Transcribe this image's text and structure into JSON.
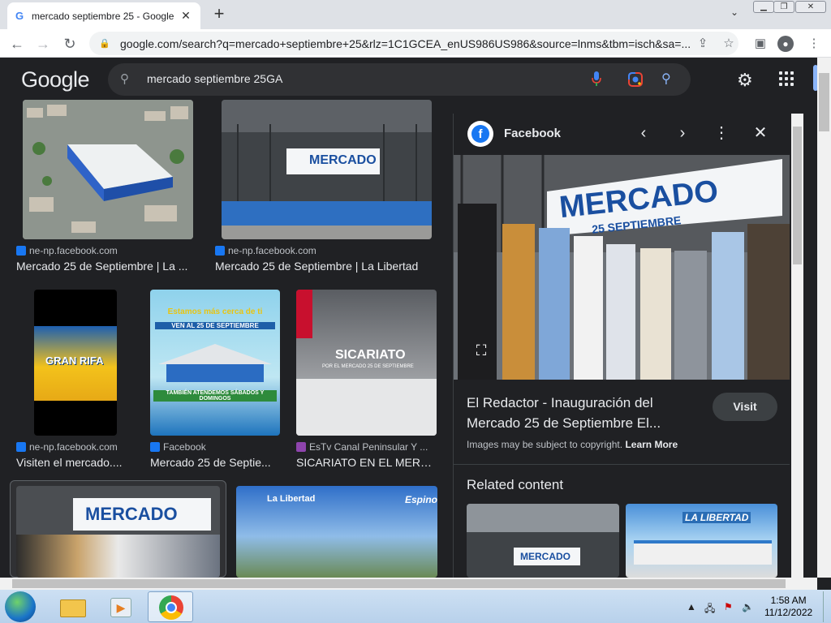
{
  "browser": {
    "tab_title": "mercado septiembre 25 - Google",
    "tab_close": "✕",
    "new_tab": "+",
    "url": "google.com/search?q=mercado+septiembre+25&rlz=1C1GCEA_enUS986US986&source=lnms&tbm=isch&sa=..."
  },
  "google": {
    "logo": "Google",
    "query": "mercado septiembre 25GA",
    "icons": {
      "search": "search-icon",
      "mic": "microphone-icon",
      "lens": "google-lens-icon",
      "settings": "gear-icon",
      "apps": "apps-grid-icon"
    }
  },
  "results": [
    {
      "source": "ne-np.facebook.com",
      "title": "Mercado 25 de Septiembre | La ..."
    },
    {
      "source": "ne-np.facebook.com",
      "title": "Mercado 25 de Septiembre | La Libertad"
    },
    {
      "source": "ne-np.facebook.com",
      "title": "Visiten el mercado...."
    },
    {
      "source": "Facebook",
      "title": "Mercado 25 de Septie..."
    },
    {
      "source": "EsTv Canal Peninsular Y ...",
      "title": "SICARIATO EN EL MERC..."
    }
  ],
  "thumb_text": {
    "mercado": "MERCADO",
    "septiembre": "25 SEPTIEMBRE",
    "gran_rifa": "GRAN RIFA",
    "estamos": "Estamos más cerca de ti",
    "ven": "VEN AL 25 DE SEPTIEMBRE",
    "tambien": "TAMBIÉN ATENDEMOS SÁBADOS Y DOMINGOS",
    "sicariato": "SICARIATO",
    "sicariato_sub": "POR EL MERCADO 25 DE SEPTIEMBRE",
    "la_libertad": "La Libertad",
    "espino": "Espino"
  },
  "panel": {
    "source": "Facebook",
    "title": "El Redactor - Inauguración del Mercado 25 de Septiembre El...",
    "visit": "Visit",
    "copyright": "Images may be subject to copyright.",
    "learn_more": "Learn More",
    "related": "Related content",
    "banner_mercado": "MERCADO",
    "banner_sept": "25 SEPTIEMBRE",
    "related_thumb_1": "MERCADO",
    "related_thumb_2": "LA LIBERTAD"
  },
  "taskbar": {
    "time": "1:58 AM",
    "date": "11/12/2022"
  }
}
